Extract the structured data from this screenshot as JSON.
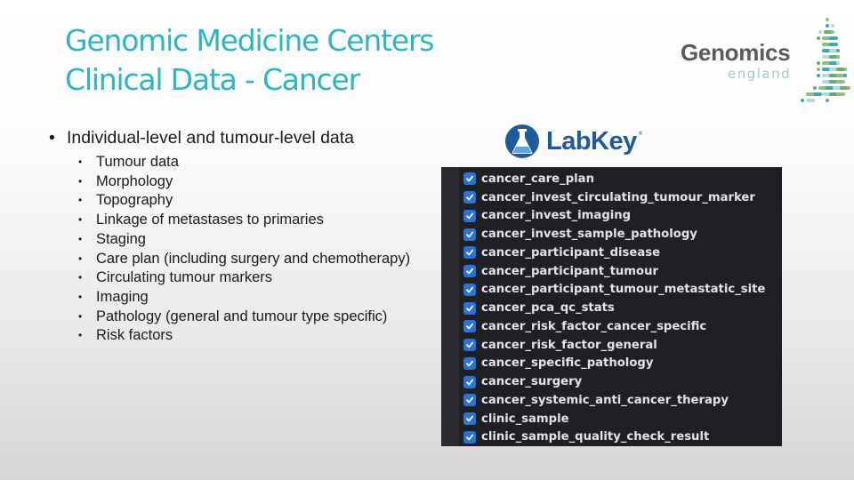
{
  "slide": {
    "title_lines": [
      "Genomic Medicine Centers",
      "Clinical Data - Cancer"
    ],
    "colors": {
      "title": "#2cb5c4",
      "panel_bg": "#1f2024",
      "checkbox": "#2a73d9"
    }
  },
  "logos": {
    "genomics_england": {
      "word": "Genomics",
      "sub": "england"
    },
    "labkey": {
      "word": "LabKey",
      "reg": "®"
    }
  },
  "bullets": {
    "main": "Individual-level and tumour-level data",
    "items": [
      "Tumour data",
      "Morphology",
      "Topography",
      "Linkage of metastases to primaries",
      "Staging",
      "Care plan (including surgery and chemotherapy)",
      "Circulating tumour markers",
      "Imaging",
      "Pathology (general and tumour type specific)",
      "Risk factors"
    ]
  },
  "table_list": {
    "items": [
      {
        "label": "cancer_care_plan",
        "checked": true
      },
      {
        "label": "cancer_invest_circulating_tumour_marker",
        "checked": true
      },
      {
        "label": "cancer_invest_imaging",
        "checked": true
      },
      {
        "label": "cancer_invest_sample_pathology",
        "checked": true
      },
      {
        "label": "cancer_participant_disease",
        "checked": true
      },
      {
        "label": "cancer_participant_tumour",
        "checked": true
      },
      {
        "label": "cancer_participant_tumour_metastatic_site",
        "checked": true
      },
      {
        "label": "cancer_pca_qc_stats",
        "checked": true
      },
      {
        "label": "cancer_risk_factor_cancer_specific",
        "checked": true
      },
      {
        "label": "cancer_risk_factor_general",
        "checked": true
      },
      {
        "label": "cancer_specific_pathology",
        "checked": true
      },
      {
        "label": "cancer_surgery",
        "checked": true
      },
      {
        "label": "cancer_systemic_anti_cancer_therapy",
        "checked": true
      },
      {
        "label": "clinic_sample",
        "checked": true
      },
      {
        "label": "clinic_sample_quality_check_result",
        "checked": true
      }
    ]
  }
}
